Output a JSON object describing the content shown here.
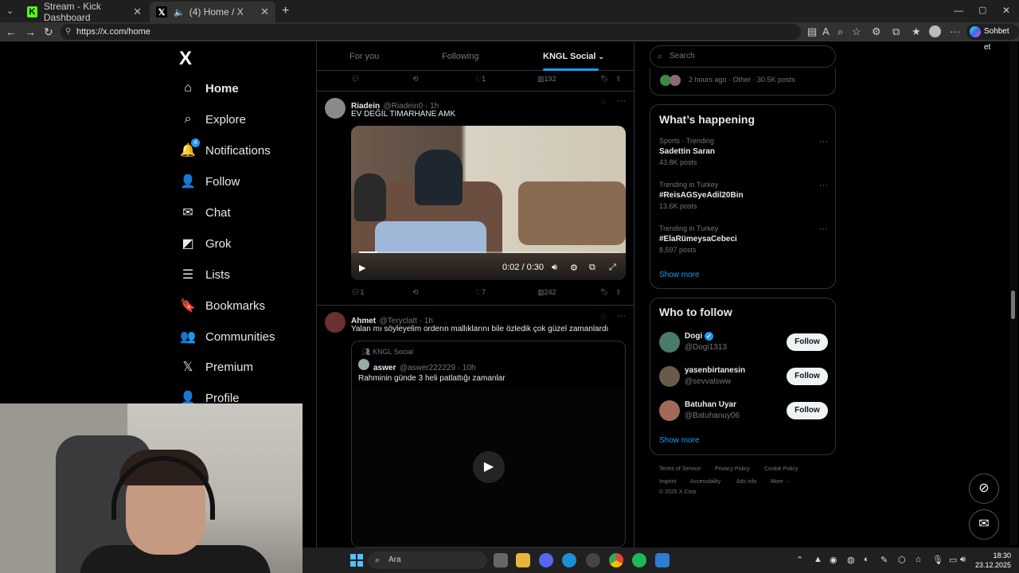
{
  "browser": {
    "tabs": [
      {
        "title": "Stream - Kick Dashboard",
        "favicon_color": "#53fc18"
      },
      {
        "title": "(4) Home / X",
        "favicon_color": "#ffffff"
      }
    ],
    "url": "https://x.com/home",
    "copilot_label": "Sohbet et"
  },
  "sidebar": {
    "logo": "X",
    "items": [
      {
        "label": "Home",
        "icon": "home-icon",
        "glyph": "⌂"
      },
      {
        "label": "Explore",
        "icon": "search-icon",
        "glyph": "⌕"
      },
      {
        "label": "Notifications",
        "icon": "bell-icon",
        "glyph": "🔔",
        "badge": "4"
      },
      {
        "label": "Follow",
        "icon": "add-person-icon",
        "glyph": "👤"
      },
      {
        "label": "Chat",
        "icon": "mail-icon",
        "glyph": "✉"
      },
      {
        "label": "Grok",
        "icon": "grok-icon",
        "glyph": "◩"
      },
      {
        "label": "Lists",
        "icon": "list-icon",
        "glyph": "☰"
      },
      {
        "label": "Bookmarks",
        "icon": "bookmark-icon",
        "glyph": "🔖"
      },
      {
        "label": "Communities",
        "icon": "communities-icon",
        "glyph": "👥"
      },
      {
        "label": "Premium",
        "icon": "x-premium-icon",
        "glyph": "𝕏"
      },
      {
        "label": "Profile",
        "icon": "profile-icon",
        "glyph": "👤"
      }
    ]
  },
  "feed": {
    "tabs": [
      {
        "label": "For you"
      },
      {
        "label": "Following"
      },
      {
        "label": "KNGL Social"
      }
    ],
    "top_actions": {
      "replies": "",
      "reposts": "",
      "likes": "1",
      "views": "192"
    },
    "posts": [
      {
        "name": "Riadein",
        "handle": "@Riadein0 · 1h",
        "text": "EV DEĞİL TIMARHANE AMK",
        "video_time": "0:02 / 0:30",
        "video_progress": 0.07,
        "replies": "1",
        "reposts": "",
        "likes": "7",
        "views": "242"
      },
      {
        "name": "Ahmet",
        "handle": "@Teryclatt · 1h",
        "text": "Yalan mı söyleyelim orderın mallıklarını bile özledik çok güzel zamanlardı",
        "quote": {
          "community": "KNGL Social",
          "name": "aswer",
          "handle": "@aswer222229 · 10h",
          "text": "Rahminin günde 3 heli patlattığı zamanlar"
        }
      }
    ]
  },
  "right": {
    "search_placeholder": "Search",
    "top_snippet": "2 hours ago · Other · 30.5K posts",
    "whats_happening": {
      "title": "What’s happening",
      "trends": [
        {
          "category": "Sports · Trending",
          "name": "Sadettin Saran",
          "count": "43.8K posts"
        },
        {
          "category": "Trending in Turkey",
          "name": "#ReisAGSyeAdil20Bin",
          "count": "13.6K posts"
        },
        {
          "category": "Trending in Turkey",
          "name": "#ElaRümeysaCebeci",
          "count": "8,597 posts"
        }
      ],
      "show_more": "Show more"
    },
    "who_to_follow": {
      "title": "Who to follow",
      "people": [
        {
          "name": "Dogi",
          "handle": "@Dogi1313",
          "button": "Follow",
          "verified": true,
          "avatar_color": "#4a7a6a"
        },
        {
          "name": "yasenbirtanesin",
          "handle": "@sevvalsww",
          "button": "Follow",
          "verified": false,
          "avatar_color": "#6a5a4a"
        },
        {
          "name": "Batuhan Uyar",
          "handle": "@Batuhanuy06",
          "button": "Follow",
          "verified": false,
          "avatar_color": "#a06a5a"
        }
      ],
      "show_more": "Show more"
    },
    "footer": {
      "links": [
        "Terms of Service",
        "Privacy Policy",
        "Cookie Policy",
        "Imprint",
        "Accessibility",
        "Ads info",
        "More ···"
      ],
      "copyright": "© 2025 X Corp."
    }
  },
  "taskbar": {
    "search_label": "Ara",
    "time": "18:30",
    "date": "23.12.2025"
  }
}
